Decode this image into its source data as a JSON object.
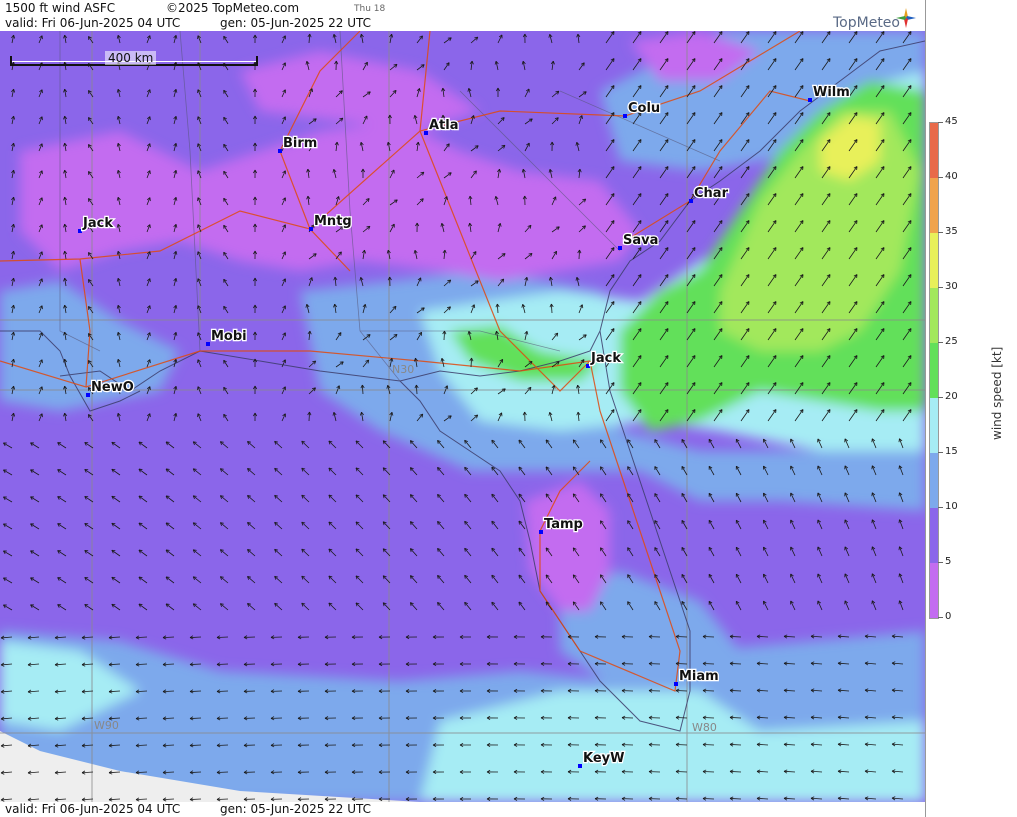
{
  "header": {
    "title": "1500 ft wind ASFC",
    "copyright": "©2025 TopMeteo.com",
    "valid": "valid:  Fri  06-Jun-2025  04 UTC",
    "gen": "gen: 05-Jun-2025 22 UTC",
    "thu": "Thu 18"
  },
  "logo": {
    "text": "TopMeteo"
  },
  "scalebar": {
    "label": "400 km"
  },
  "footer": {
    "valid": "valid:  Fri  06-Jun-2025  04 UTC",
    "gen": "gen: 05-Jun-2025 22 UTC"
  },
  "legend": {
    "axis_label": "wind speed [kt]",
    "ticks": [
      "45",
      "40",
      "35",
      "30",
      "25",
      "20",
      "15",
      "10",
      "5",
      "0"
    ],
    "colors": [
      "#c36cf0",
      "#8b66ea",
      "#7da9ec",
      "#a6ecf4",
      "#62e05a",
      "#a2e85c",
      "#e8f05a",
      "#f0a34c",
      "#e86a4a"
    ]
  },
  "map": {
    "cities": [
      {
        "name": "Birm"
      },
      {
        "name": "Atla"
      },
      {
        "name": "Colu"
      },
      {
        "name": "Wilm"
      },
      {
        "name": "Char"
      },
      {
        "name": "Jack"
      },
      {
        "name": "Mntg"
      },
      {
        "name": "Sava"
      },
      {
        "name": "Mobi"
      },
      {
        "name": "Jack"
      },
      {
        "name": "NewO"
      },
      {
        "name": "Tamp"
      },
      {
        "name": "Miam"
      },
      {
        "name": "KeyW"
      }
    ],
    "grid_labels": [
      "N30",
      "W90",
      "W80"
    ]
  },
  "colors": {
    "route": "#e04a10",
    "city_dot": "#0000ff"
  }
}
